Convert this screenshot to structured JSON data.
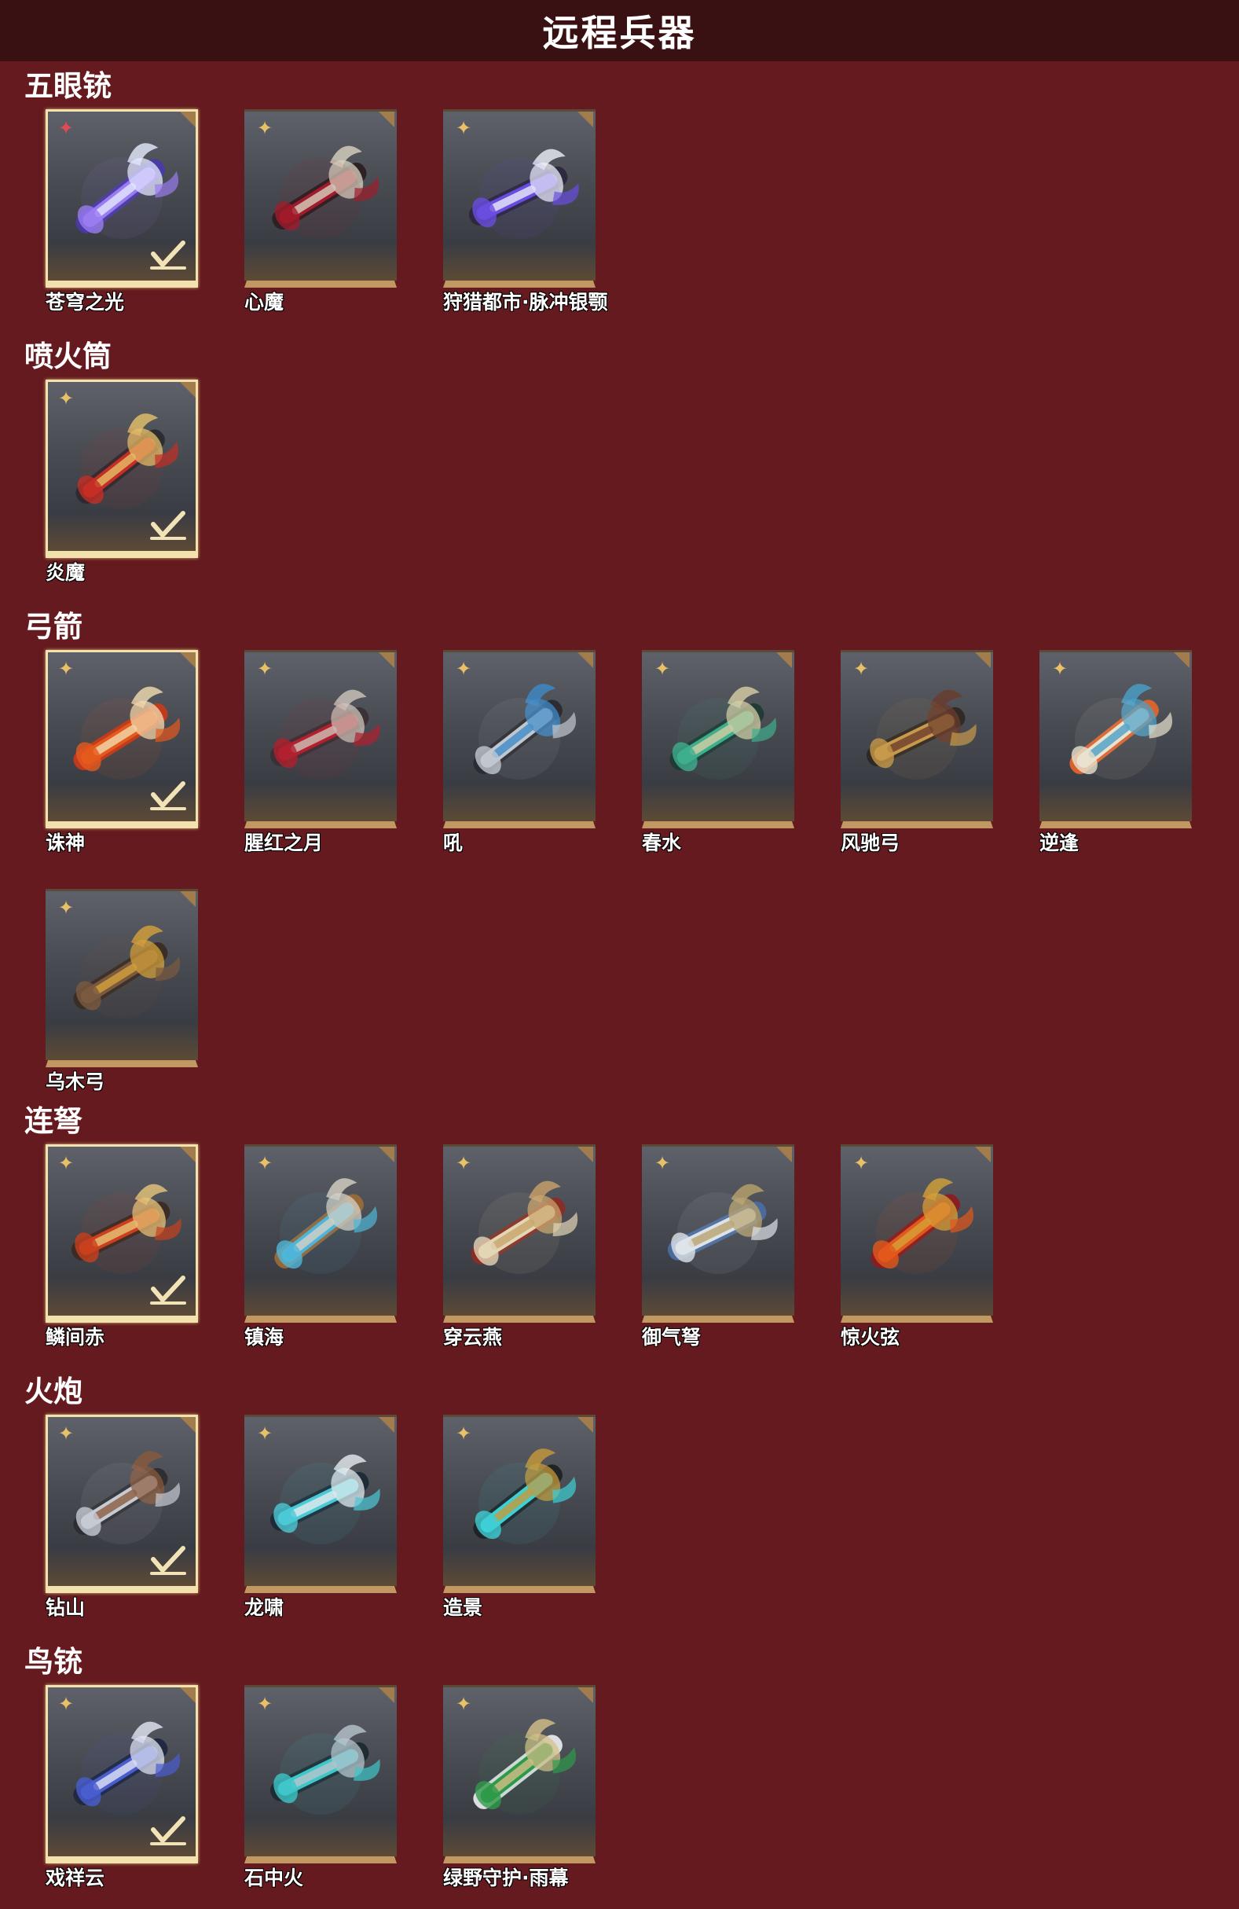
{
  "header": {
    "title": "远程兵器"
  },
  "sections": [
    {
      "title": "五眼铳",
      "items": [
        {
          "name": "苍穹之光",
          "badge": "red-flower-icon",
          "selected": true,
          "palette": [
            "#9a7cf0",
            "#e6ecff",
            "#4a3aa8"
          ]
        },
        {
          "name": "心魔",
          "badge": "gold-flower-icon",
          "selected": false,
          "palette": [
            "#a01c2c",
            "#d8d3c2",
            "#2b1f22"
          ]
        },
        {
          "name": "狩猎都市·脉冲银颚",
          "badge": "gold-flower-icon",
          "selected": false,
          "palette": [
            "#6a4ee0",
            "#eef0fa",
            "#2c2740"
          ]
        }
      ]
    },
    {
      "title": "喷火筒",
      "items": [
        {
          "name": "炎魔",
          "badge": "gold-flower-icon",
          "selected": true,
          "palette": [
            "#c52e25",
            "#e7c26a",
            "#2a2a30"
          ]
        }
      ]
    },
    {
      "title": "弓箭",
      "items": [
        {
          "name": "诛神",
          "badge": "gold-flower-icon",
          "selected": true,
          "palette": [
            "#e55a1e",
            "#f2ddb1",
            "#c43a1a"
          ]
        },
        {
          "name": "腥红之月",
          "badge": "gold-flower-icon",
          "selected": false,
          "palette": [
            "#b0202e",
            "#cfc6bc",
            "#3a3036"
          ]
        },
        {
          "name": "吼",
          "badge": "gold-flower-icon",
          "selected": false,
          "palette": [
            "#c2c7cf",
            "#3d89c9",
            "#2a2a30"
          ]
        },
        {
          "name": "春水",
          "badge": "gold-flower-icon",
          "selected": false,
          "palette": [
            "#3fae8e",
            "#d8cfa6",
            "#1f3a34"
          ]
        },
        {
          "name": "风驰弓",
          "badge": "gold-flower-icon",
          "selected": false,
          "palette": [
            "#c79a4a",
            "#6a3b2c",
            "#2e2824"
          ]
        },
        {
          "name": "逆逢",
          "badge": "gold-flower-icon",
          "selected": false,
          "palette": [
            "#e9e2cf",
            "#4aa0c9",
            "#e0642c"
          ]
        },
        {
          "name": "乌木弓",
          "badge": "gold-flower-icon",
          "selected": false,
          "palette": [
            "#7a5a40",
            "#d6a33a",
            "#3a2c24"
          ]
        }
      ]
    },
    {
      "title": "连弩",
      "items": [
        {
          "name": "鳞间赤",
          "badge": "gold-flower-icon",
          "selected": true,
          "palette": [
            "#c8401e",
            "#e9c77a",
            "#3a2a24"
          ]
        },
        {
          "name": "镇海",
          "badge": "gold-flower-icon",
          "selected": false,
          "palette": [
            "#4fb6d9",
            "#d8d2c4",
            "#9a6a3a"
          ]
        },
        {
          "name": "穿云燕",
          "badge": "gold-flower-icon",
          "selected": false,
          "palette": [
            "#e2d6b6",
            "#c9a36a",
            "#8a2c24"
          ]
        },
        {
          "name": "御气弩",
          "badge": "gold-flower-icon",
          "selected": false,
          "palette": [
            "#dfe3ea",
            "#b9a26c",
            "#4a6da0"
          ]
        },
        {
          "name": "惊火弦",
          "badge": "gold-flower-icon",
          "selected": false,
          "palette": [
            "#e2571c",
            "#d6a238",
            "#8a1c22"
          ]
        }
      ]
    },
    {
      "title": "火炮",
      "items": [
        {
          "name": "钻山",
          "badge": "gold-flower-icon",
          "selected": true,
          "palette": [
            "#c6cbd3",
            "#8a5a3c",
            "#2c2c32"
          ]
        },
        {
          "name": "龙啸",
          "badge": "gold-flower-icon",
          "selected": false,
          "palette": [
            "#4cc9d6",
            "#e6ecf0",
            "#1c2a36"
          ]
        },
        {
          "name": "造景",
          "badge": "gold-flower-icon",
          "selected": false,
          "palette": [
            "#3fd0d6",
            "#c79a3a",
            "#1c2224"
          ]
        }
      ]
    },
    {
      "title": "鸟铳",
      "items": [
        {
          "name": "戏祥云",
          "badge": "gold-flower-icon",
          "selected": true,
          "palette": [
            "#4a5ed0",
            "#e4e8f4",
            "#202840"
          ]
        },
        {
          "name": "石中火",
          "badge": "gold-flower-icon",
          "selected": false,
          "palette": [
            "#3ec6c8",
            "#b9c4cc",
            "#1c2a30"
          ]
        },
        {
          "name": "绿野守护·雨幕",
          "badge": "gold-flower-icon",
          "selected": false,
          "palette": [
            "#2f9a4a",
            "#d6c08a",
            "#e4e8ea"
          ]
        }
      ]
    }
  ]
}
